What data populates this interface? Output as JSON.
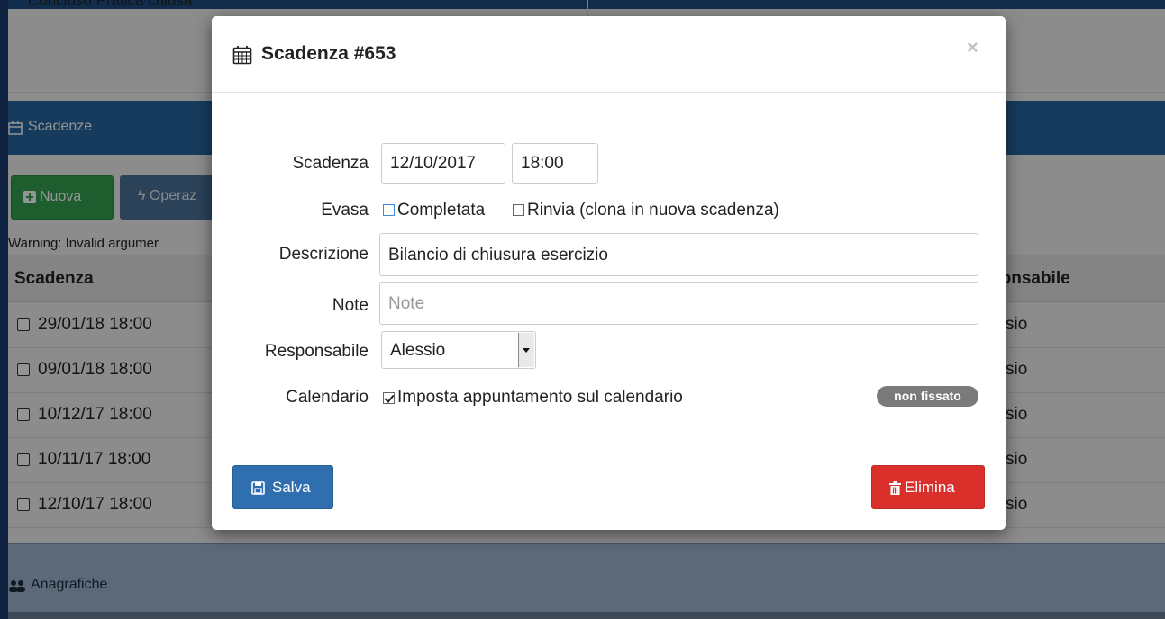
{
  "background": {
    "top_strip_text": "Concluso   Pratica chiusa",
    "panel_title": "Scadenze",
    "new_button": "Nuova",
    "operations_button": "Operaz",
    "warning": "Warning: Invalid argumer",
    "table": {
      "col_scadenza": "Scadenza",
      "col_responsabile": "ponsabile",
      "rows": [
        {
          "date": "29/01/18 18:00",
          "resp": "sio"
        },
        {
          "date": "09/01/18 18:00",
          "resp": "sio"
        },
        {
          "date": "10/12/17 18:00",
          "resp": "sio"
        },
        {
          "date": "10/11/17 18:00",
          "resp": "sio"
        },
        {
          "date": "12/10/17 18:00",
          "resp": "sio"
        }
      ]
    },
    "panel2_title": "Anagrafiche"
  },
  "modal": {
    "title": "Scadenza #653",
    "close": "×",
    "fields": {
      "scadenza_label": "Scadenza",
      "date_value": "12/10/2017",
      "time_value": "18:00",
      "evasa_label": "Evasa",
      "completata": "Completata",
      "rinvia": "Rinvia (clona in nuova scadenza)",
      "descrizione_label": "Descrizione",
      "descrizione_value": "Bilancio di chiusura esercizio",
      "note_label": "Note",
      "note_placeholder": "Note",
      "responsabile_label": "Responsabile",
      "responsabile_value": "Alessio",
      "calendario_label": "Calendario",
      "calendario_checkbox": "Imposta appuntamento sul calendario",
      "badge": "non fissato"
    },
    "save_button": "Salva",
    "delete_button": "Elimina"
  },
  "colors": {
    "primary": "#2f6fb0",
    "danger": "#d9302c",
    "success": "#35a14f",
    "panel_header": "#26679f"
  }
}
